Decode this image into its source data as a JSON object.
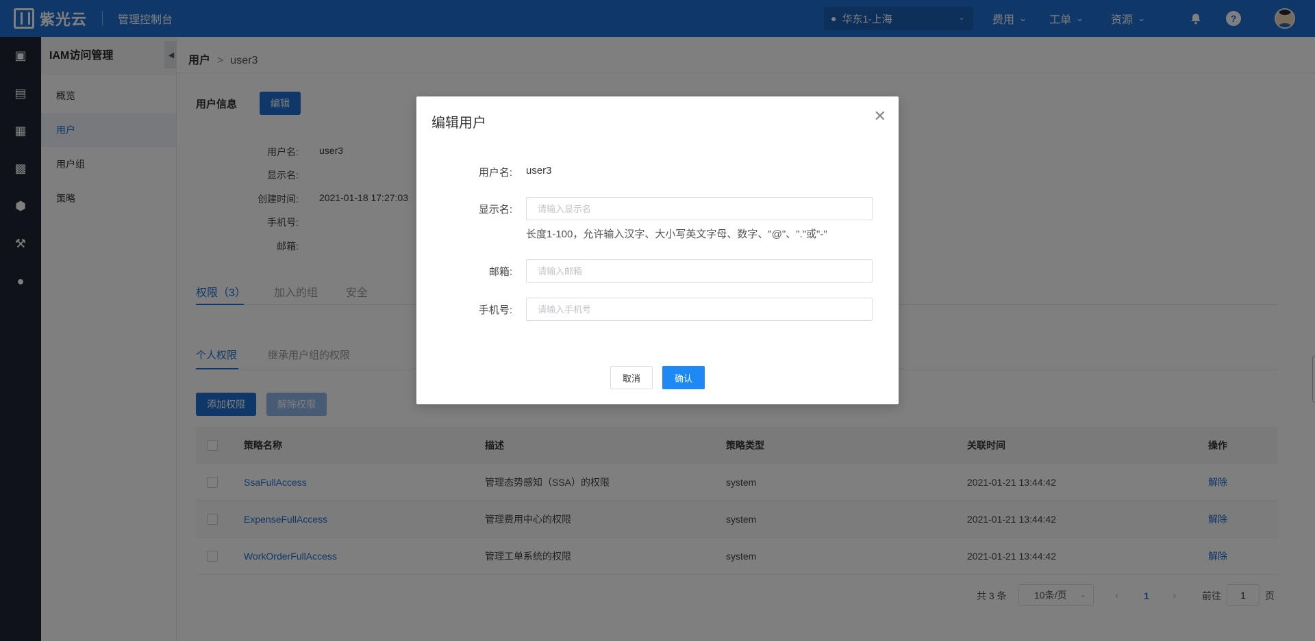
{
  "topbar": {
    "brand": "紫光云",
    "console_title": "管理控制台",
    "region": "华东1-上海",
    "nav": [
      "费用",
      "工单",
      "资源"
    ]
  },
  "sidebar": {
    "title": "IAM访问管理",
    "items": [
      {
        "label": "概览"
      },
      {
        "label": "用户"
      },
      {
        "label": "用户组"
      },
      {
        "label": "策略"
      }
    ]
  },
  "breadcrumb": {
    "parent": "用户",
    "separator": ">",
    "current": "user3"
  },
  "user_info": {
    "title": "用户信息",
    "edit_label": "编辑",
    "fields": [
      {
        "label": "用户名:",
        "value": "user3"
      },
      {
        "label": "显示名:",
        "value": ""
      },
      {
        "label": "创建时间:",
        "value": "2021-01-18 17:27:03"
      },
      {
        "label": "手机号:",
        "value": ""
      },
      {
        "label": "邮箱:",
        "value": ""
      }
    ]
  },
  "tabs": {
    "main": [
      "权限（3）",
      "加入的组",
      "安全"
    ],
    "sub": [
      "个人权限",
      "继承用户组的权限"
    ]
  },
  "actions": {
    "add": "添加权限",
    "remove": "解除权限"
  },
  "table": {
    "headers": [
      "策略名称",
      "描述",
      "策略类型",
      "关联时间",
      "操作"
    ],
    "rows": [
      {
        "name": "SsaFullAccess",
        "desc": "管理态势感知（SSA）的权限",
        "type": "system",
        "time": "2021-01-21 13:44:42",
        "action": "解除"
      },
      {
        "name": "ExpenseFullAccess",
        "desc": "管理费用中心的权限",
        "type": "system",
        "time": "2021-01-21 13:44:42",
        "action": "解除"
      },
      {
        "name": "WorkOrderFullAccess",
        "desc": "管理工单系统的权限",
        "type": "system",
        "time": "2021-01-21 13:44:42",
        "action": "解除"
      }
    ]
  },
  "pagination": {
    "total": "共 3 条",
    "page_size": "10条/页",
    "current": "1",
    "goto_prefix": "前往",
    "goto_value": "1",
    "goto_suffix": "页"
  },
  "modal": {
    "title": "编辑用户",
    "username_label": "用户名:",
    "username_value": "user3",
    "display_label": "显示名:",
    "display_placeholder": "请输入显示名",
    "hint": "长度1-100，允许输入汉字、大小写英文字母、数字、\"@\"、\".\"或\"-\"",
    "email_label": "邮箱:",
    "email_placeholder": "请输入邮箱",
    "phone_label": "手机号:",
    "phone_placeholder": "请输入手机号",
    "cancel": "取消",
    "confirm": "确认"
  },
  "colors": {
    "primary": "#1f6fd1",
    "confirm": "#1e88f5",
    "rail": "#1e2530"
  }
}
